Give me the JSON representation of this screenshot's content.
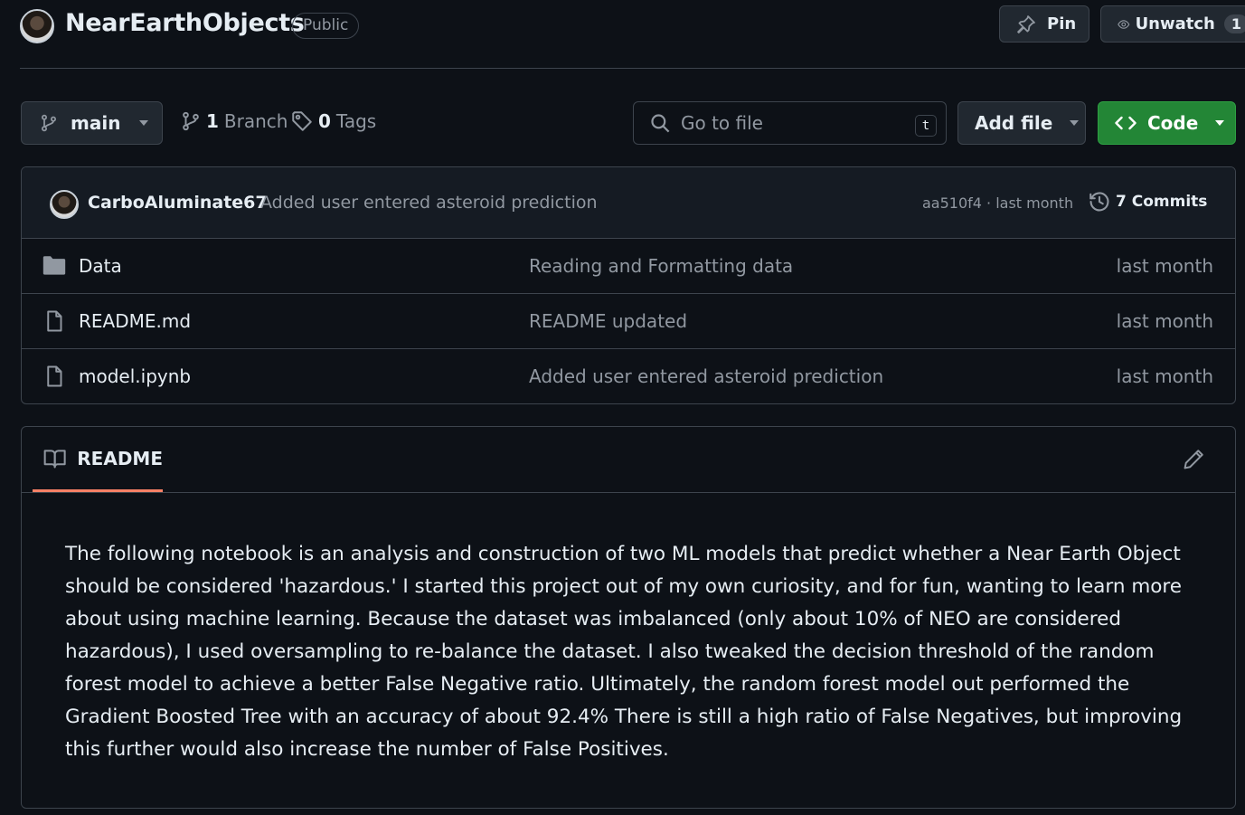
{
  "repo": {
    "name": "NearEarthObjects",
    "visibility": "Public",
    "pin_label": "Pin",
    "unwatch_label": "Unwatch",
    "watch_count": "1"
  },
  "toolbar": {
    "branch": "main",
    "branch_count": "1",
    "branch_label": "Branch",
    "tag_count": "0",
    "tag_label": "Tags",
    "goto_placeholder": "Go to file",
    "goto_shortcut": "t",
    "add_file_label": "Add file",
    "code_label": "Code"
  },
  "latest_commit": {
    "author": "CarboAluminate67",
    "message": "Added user entered asteroid prediction",
    "meta": "aa510f4 · last month",
    "commits_label": "7 Commits"
  },
  "files": [
    {
      "type": "folder",
      "name": "Data",
      "commit": "Reading and Formatting data",
      "date": "last month"
    },
    {
      "type": "file",
      "name": "README.md",
      "commit": "README updated",
      "date": "last month"
    },
    {
      "type": "file",
      "name": "model.ipynb",
      "commit": "Added user entered asteroid prediction",
      "date": "last month"
    }
  ],
  "readme": {
    "tab_label": "README",
    "text": "The following notebook is an analysis and construction of two ML models that predict whether a Near Earth Object should be considered 'hazardous.' I started this project out of my own curiosity, and for fun, wanting to learn more about using machine learning. Because the dataset was imbalanced (only about 10% of NEO are considered hazardous), I used oversampling to re-balance the dataset. I also tweaked the decision threshold of the random forest model to achieve a better False Negative ratio. Ultimately, the random forest model out performed the Gradient Boosted Tree with an accuracy of about 92.4% There is still a high ratio of False Negatives, but improving this further would also increase the number of False Positives."
  },
  "icons": {
    "pin": "pin-icon",
    "eye": "eye-icon",
    "branch": "git-branch-icon",
    "tag": "tag-icon",
    "search": "search-icon",
    "code": "code-icon",
    "history": "history-icon",
    "folder": "folder-icon",
    "file": "file-icon",
    "book": "book-icon",
    "pencil": "pencil-icon"
  },
  "colors": {
    "background": "#0d1117",
    "border": "#3d444d",
    "code_button": "#238636",
    "readme_tab_underline": "#f78166"
  }
}
